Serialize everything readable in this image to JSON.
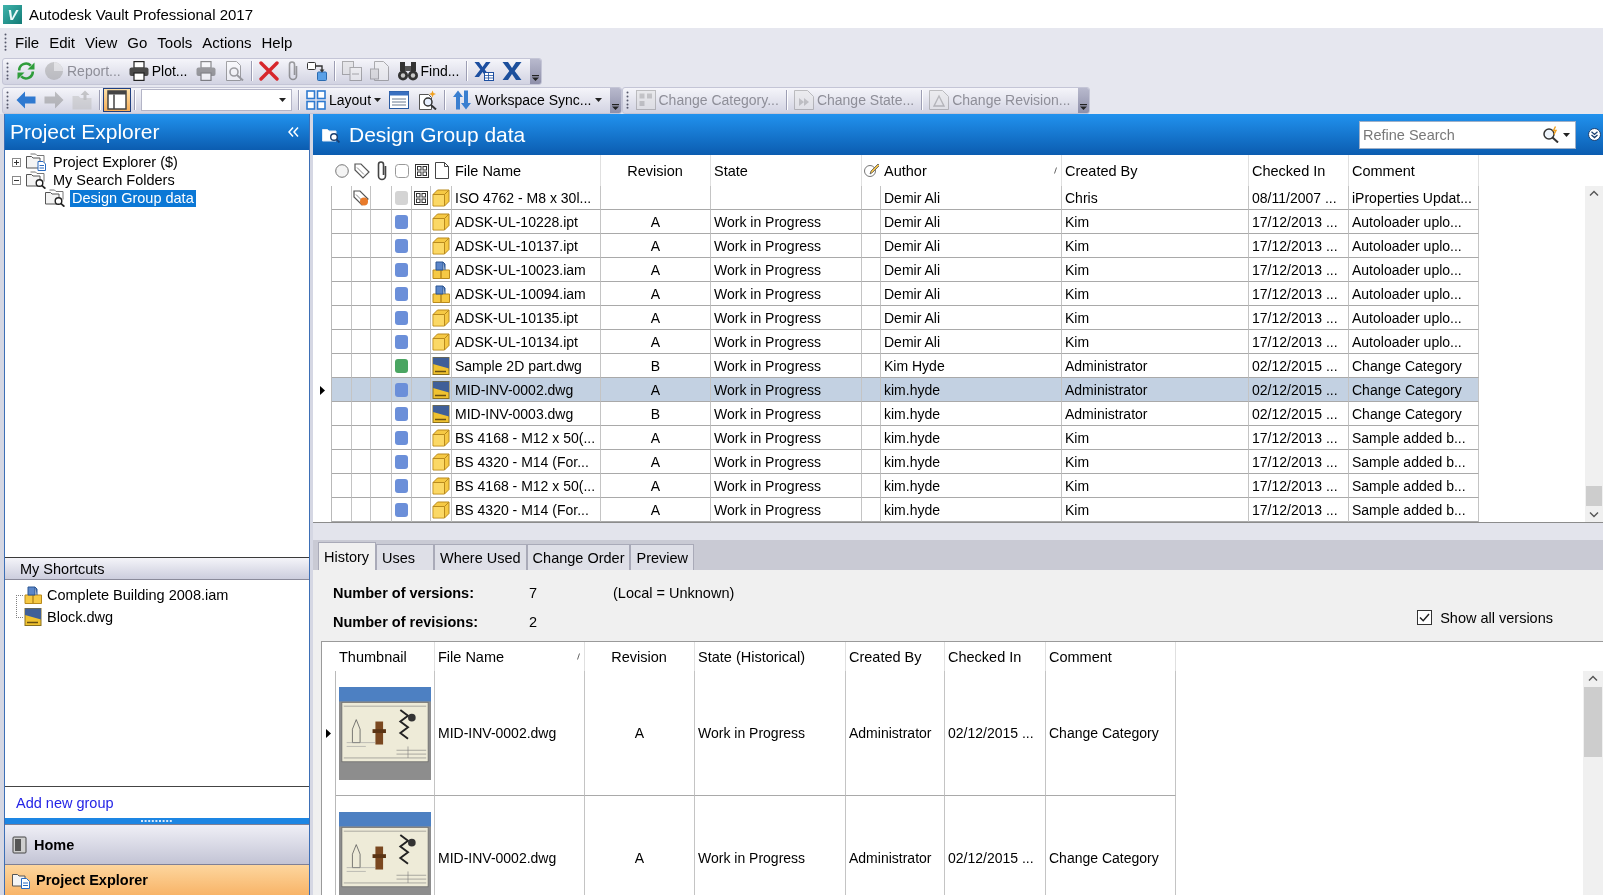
{
  "window": {
    "logo": "V",
    "title": "Autodesk Vault Professional 2017"
  },
  "menu": [
    "File",
    "Edit",
    "View",
    "Go",
    "Tools",
    "Actions",
    "Help"
  ],
  "toolbars": [
    {
      "items": [
        {
          "kind": "button",
          "disabled": false
        },
        {
          "kind": "button",
          "label": "Report...",
          "disabled": true
        },
        {
          "kind": "button",
          "label": "Plot...",
          "disabled": false
        },
        {
          "kind": "button",
          "disabled": true
        },
        {
          "kind": "button",
          "disabled": true
        },
        {
          "kind": "separator"
        },
        {
          "kind": "button",
          "disabled": false
        },
        {
          "kind": "button",
          "disabled": true
        },
        {
          "kind": "button",
          "disabled": false
        },
        {
          "kind": "separator"
        },
        {
          "kind": "button",
          "disabled": true
        },
        {
          "kind": "button",
          "disabled": true
        },
        {
          "kind": "button",
          "label": "Find...",
          "disabled": false
        },
        {
          "kind": "separator"
        },
        {
          "kind": "button",
          "disabled": false
        },
        {
          "kind": "button",
          "disabled": false
        }
      ]
    },
    {
      "items": [
        {
          "kind": "button",
          "disabled": false
        },
        {
          "kind": "button",
          "disabled": true
        },
        {
          "kind": "button",
          "disabled": true
        },
        {
          "kind": "separator"
        },
        {
          "kind": "toggle",
          "on": true
        },
        {
          "kind": "separator"
        },
        {
          "kind": "combo"
        },
        {
          "kind": "separator"
        },
        {
          "kind": "dropdown",
          "label": "Layout",
          "disabled": false
        },
        {
          "kind": "button",
          "disabled": false
        },
        {
          "kind": "button",
          "disabled": false
        },
        {
          "kind": "separator"
        },
        {
          "kind": "dropdown",
          "label": "Workspace Sync...",
          "disabled": false
        }
      ]
    },
    {
      "items": [
        {
          "kind": "button",
          "label": "Change Category...",
          "disabled": true
        },
        {
          "kind": "separator"
        },
        {
          "kind": "button",
          "label": "Change State...",
          "disabled": true
        },
        {
          "kind": "separator"
        },
        {
          "kind": "button",
          "label": "Change Revision...",
          "disabled": true
        }
      ]
    }
  ],
  "explorer": {
    "title": "Project Explorer",
    "tree": [
      {
        "label": "Project Explorer ($)",
        "kind": "vault",
        "expanded": false,
        "selected": false
      },
      {
        "label": "My Search Folders",
        "kind": "search_folder",
        "expanded": true,
        "selected": false,
        "children": [
          {
            "label": "Design Group data",
            "kind": "search_folder",
            "selected": true
          }
        ]
      }
    ]
  },
  "shortcuts": {
    "title": "My Shortcuts",
    "items": [
      {
        "label": "Complete Building 2008.iam",
        "kind": "assembly"
      },
      {
        "label": "Block.dwg",
        "kind": "drawing"
      }
    ],
    "add_group": "Add new group"
  },
  "nav": [
    {
      "label": "Home",
      "selected": false
    },
    {
      "label": "Project Explorer",
      "selected": true
    }
  ],
  "view": {
    "title": "Design Group data",
    "search": {
      "placeholder": "Refine Search"
    }
  },
  "grid": {
    "columns": [
      "File Name",
      "Revision",
      "State",
      "Author",
      "Created By",
      "Checked In",
      "Comment"
    ],
    "rows": [
      {
        "selected": false,
        "tagged": true,
        "grid_mark": true,
        "color": "#d4d4d4",
        "kind": "part",
        "file_name": "ISO 4762 - M8 x 30l...",
        "author": "Demir Ali",
        "created_by": "Chris",
        "checked_in": "08/11/2007 ...",
        "comment": "iProperties Updat..."
      },
      {
        "selected": false,
        "tagged": false,
        "grid_mark": false,
        "color": "#6b8fd9",
        "kind": "part",
        "file_name": "ADSK-UL-10228.ipt",
        "revision": "A",
        "state": "Work in Progress",
        "author": "Demir Ali",
        "created_by": "Kim",
        "checked_in": "17/12/2013 ...",
        "comment": "Autoloader uplo..."
      },
      {
        "selected": false,
        "tagged": false,
        "grid_mark": false,
        "color": "#6b8fd9",
        "kind": "part",
        "file_name": "ADSK-UL-10137.ipt",
        "revision": "A",
        "state": "Work in Progress",
        "author": "Demir Ali",
        "created_by": "Kim",
        "checked_in": "17/12/2013 ...",
        "comment": "Autoloader uplo..."
      },
      {
        "selected": false,
        "tagged": false,
        "grid_mark": false,
        "color": "#6b8fd9",
        "kind": "assembly",
        "file_name": "ADSK-UL-10023.iam",
        "revision": "A",
        "state": "Work in Progress",
        "author": "Demir Ali",
        "created_by": "Kim",
        "checked_in": "17/12/2013 ...",
        "comment": "Autoloader uplo..."
      },
      {
        "selected": false,
        "tagged": false,
        "grid_mark": false,
        "color": "#6b8fd9",
        "kind": "assembly",
        "file_name": "ADSK-UL-10094.iam",
        "revision": "A",
        "state": "Work in Progress",
        "author": "Demir Ali",
        "created_by": "Kim",
        "checked_in": "17/12/2013 ...",
        "comment": "Autoloader uplo..."
      },
      {
        "selected": false,
        "tagged": false,
        "grid_mark": false,
        "color": "#6b8fd9",
        "kind": "part",
        "file_name": "ADSK-UL-10135.ipt",
        "revision": "A",
        "state": "Work in Progress",
        "author": "Demir Ali",
        "created_by": "Kim",
        "checked_in": "17/12/2013 ...",
        "comment": "Autoloader uplo..."
      },
      {
        "selected": false,
        "tagged": false,
        "grid_mark": false,
        "color": "#6b8fd9",
        "kind": "part",
        "file_name": "ADSK-UL-10134.ipt",
        "revision": "A",
        "state": "Work in Progress",
        "author": "Demir Ali",
        "created_by": "Kim",
        "checked_in": "17/12/2013 ...",
        "comment": "Autoloader uplo..."
      },
      {
        "selected": false,
        "tagged": false,
        "grid_mark": false,
        "color": "#4aa562",
        "kind": "drawing",
        "file_name": "Sample 2D part.dwg",
        "revision": "B",
        "state": "Work in Progress",
        "author": "Kim Hyde",
        "created_by": "Administrator",
        "checked_in": "02/12/2015 ...",
        "comment": "Change Category"
      },
      {
        "selected": true,
        "tagged": false,
        "grid_mark": false,
        "color": "#6b8fd9",
        "kind": "drawing",
        "file_name": "MID-INV-0002.dwg",
        "revision": "A",
        "state": "Work in Progress",
        "author": "kim.hyde",
        "created_by": "Administrator",
        "checked_in": "02/12/2015 ...",
        "comment": "Change Category"
      },
      {
        "selected": false,
        "tagged": false,
        "grid_mark": false,
        "color": "#6b8fd9",
        "kind": "drawing",
        "file_name": "MID-INV-0003.dwg",
        "revision": "B",
        "state": "Work in Progress",
        "author": "kim.hyde",
        "created_by": "Administrator",
        "checked_in": "02/12/2015 ...",
        "comment": "Change Category"
      },
      {
        "selected": false,
        "tagged": false,
        "grid_mark": false,
        "color": "#6b8fd9",
        "kind": "part",
        "file_name": "BS 4168 - M12 x 50(...",
        "revision": "A",
        "state": "Work in Progress",
        "author": "kim.hyde",
        "created_by": "Kim",
        "checked_in": "17/12/2013 ...",
        "comment": "Sample added b..."
      },
      {
        "selected": false,
        "tagged": false,
        "grid_mark": false,
        "color": "#6b8fd9",
        "kind": "part",
        "file_name": "BS 4320 - M14 (For...",
        "revision": "A",
        "state": "Work in Progress",
        "author": "kim.hyde",
        "created_by": "Kim",
        "checked_in": "17/12/2013 ...",
        "comment": "Sample added b..."
      },
      {
        "selected": false,
        "tagged": false,
        "grid_mark": false,
        "color": "#6b8fd9",
        "kind": "part",
        "file_name": "BS 4168 - M12 x 50(...",
        "revision": "A",
        "state": "Work in Progress",
        "author": "kim.hyde",
        "created_by": "Kim",
        "checked_in": "17/12/2013 ...",
        "comment": "Sample added b..."
      },
      {
        "selected": false,
        "tagged": false,
        "grid_mark": false,
        "color": "#6b8fd9",
        "kind": "part",
        "file_name": "BS 4320 - M14 (For...",
        "revision": "A",
        "state": "Work in Progress",
        "author": "kim.hyde",
        "created_by": "Kim",
        "checked_in": "17/12/2013 ...",
        "comment": "Sample added b..."
      }
    ]
  },
  "details": {
    "tabs": [
      {
        "label": "History",
        "selected": true
      },
      {
        "label": "Uses",
        "selected": false
      },
      {
        "label": "Where Used",
        "selected": false
      },
      {
        "label": "Change Order",
        "selected": false
      },
      {
        "label": "Preview",
        "selected": false
      }
    ],
    "summary": [
      {
        "label": "Number of versions:",
        "value": "7",
        "note": "(Local = Unknown)"
      },
      {
        "label": "Number of revisions:",
        "value": "2"
      }
    ],
    "show_all_versions": {
      "label": "Show all versions",
      "checked": true
    },
    "history": {
      "columns": [
        "Thumbnail",
        "File Name",
        "Revision",
        "State (Historical)",
        "Created By",
        "Checked In",
        "Comment"
      ],
      "rows": [
        {
          "selected": true,
          "file_name": "MID-INV-0002.dwg",
          "revision": "A",
          "state": "Work in Progress",
          "created_by": "Administrator",
          "checked_in": "02/12/2015 ...",
          "comment": "Change Category"
        },
        {
          "selected": false,
          "file_name": "MID-INV-0002.dwg",
          "revision": "A",
          "state": "Work in Progress",
          "created_by": "Administrator",
          "checked_in": "02/12/2015 ...",
          "comment": "Change Category"
        }
      ]
    }
  }
}
